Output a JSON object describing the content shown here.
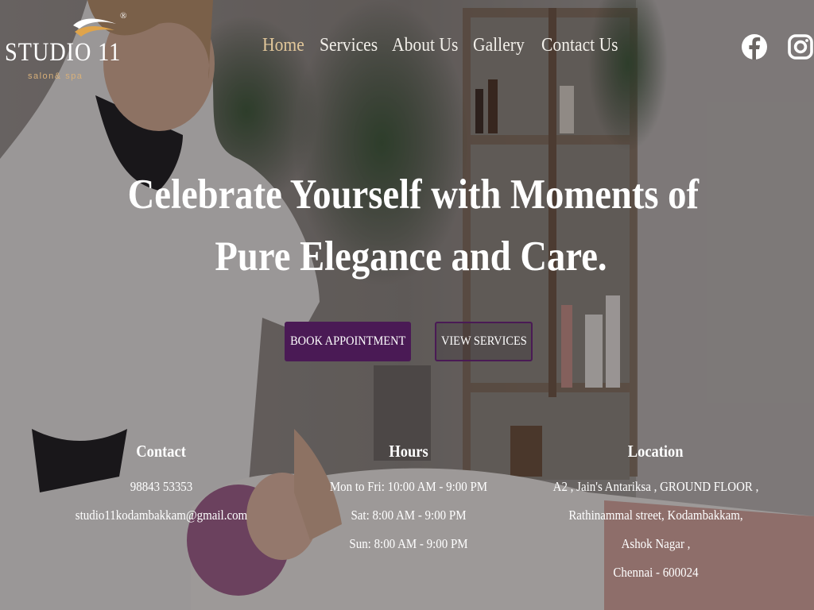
{
  "brand": {
    "name": "STUDIO 11",
    "tagline": "salon& spa",
    "registered": "®"
  },
  "nav": {
    "items": [
      {
        "label": "Home",
        "active": true
      },
      {
        "label": "Services",
        "active": false
      },
      {
        "label": "About Us",
        "active": false
      },
      {
        "label": "Gallery",
        "active": false
      },
      {
        "label": "Contact Us",
        "active": false
      }
    ]
  },
  "social": {
    "icons": [
      "facebook-icon",
      "instagram-icon"
    ]
  },
  "hero": {
    "title_line1": "Celebrate Yourself  with Moments of",
    "title_line2": "Pure Elegance and Care.",
    "primary_button": "BOOK APPOINTMENT",
    "secondary_button": "VIEW SERVICES"
  },
  "contact": {
    "heading": "Contact",
    "phone": "98843 53353",
    "email": "studio11kodambakkam@gmail.com"
  },
  "hours": {
    "heading": "Hours",
    "weekdays": "Mon to Fri: 10:00 AM - 9:00 PM",
    "saturday": "Sat: 8:00 AM - 9:00 PM",
    "sunday": "Sun: 8:00 AM - 9:00 PM"
  },
  "location": {
    "heading": "Location",
    "line1": "A2 , Jain's Antariksa , GROUND FLOOR ,",
    "line2": "Rathinammal street, Kodambakkam,",
    "line3": "Ashok Nagar ,",
    "line4": "Chennai - 600024"
  },
  "colors": {
    "accent_purple": "#4a1a55",
    "nav_active": "#e2c79a",
    "tagline_gold": "#d8b07a",
    "logo_swoosh": "#e0a44a"
  }
}
